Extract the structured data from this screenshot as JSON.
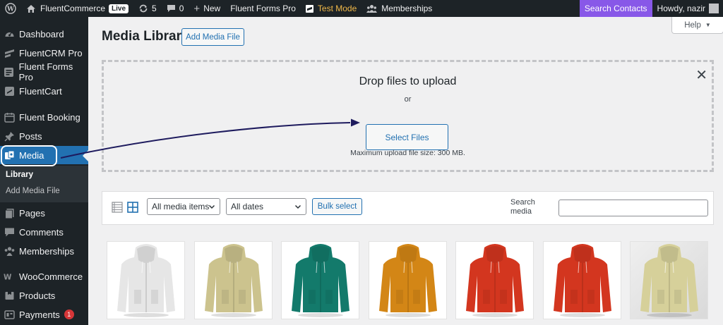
{
  "adminbar": {
    "site_name": "FluentCommerce",
    "live_badge": "Live",
    "updates_count": "5",
    "comments_count": "0",
    "new_label": "New",
    "forms_label": "Fluent Forms Pro",
    "test_mode_label": "Test Mode",
    "memberships_label": "Memberships",
    "search_contacts_label": "Search Contacts",
    "howdy_label": "Howdy, nazir"
  },
  "sidebar": {
    "items": [
      {
        "label": "Dashboard",
        "icon": "dashboard-icon"
      },
      {
        "label": "FluentCRM Pro",
        "icon": "fluentcrm-icon"
      },
      {
        "label": "Fluent Forms Pro",
        "icon": "fluentforms-icon"
      },
      {
        "label": "FluentCart",
        "icon": "fluentcart-icon"
      },
      {
        "label": "Fluent Booking",
        "icon": "calendar-icon"
      },
      {
        "label": "Posts",
        "icon": "pin-icon"
      },
      {
        "label": "Media",
        "icon": "media-icon"
      },
      {
        "label": "Pages",
        "icon": "pages-icon"
      },
      {
        "label": "Comments",
        "icon": "comments-icon"
      },
      {
        "label": "Memberships",
        "icon": "memberships-icon"
      },
      {
        "label": "WooCommerce",
        "icon": "woocommerce-icon"
      },
      {
        "label": "Products",
        "icon": "products-icon"
      },
      {
        "label": "Payments",
        "icon": "payments-icon"
      }
    ],
    "submenu": [
      "Library",
      "Add Media File"
    ],
    "payments_badge": "1"
  },
  "main": {
    "help_label": "Help",
    "title": "Media Library",
    "add_button": "Add Media File",
    "upload": {
      "title": "Drop files to upload",
      "or": "or",
      "select_button": "Select Files",
      "max_size": "Maximum upload file size: 300 MB."
    },
    "toolbar": {
      "filter_type": "All media items",
      "filter_date": "All dates",
      "bulk_select": "Bulk select",
      "search_label": "Search media",
      "search_value": ""
    },
    "thumbnails": [
      {
        "color": "#e6e6e6",
        "name": "white-hoodie"
      },
      {
        "color": "#ccc38e",
        "name": "beige-hoodie"
      },
      {
        "color": "#137a6b",
        "name": "teal-hoodie"
      },
      {
        "color": "#d38616",
        "name": "orange-hoodie"
      },
      {
        "color": "#d3361f",
        "name": "red-hoodie"
      },
      {
        "color": "#d3361f",
        "name": "red-hoodie"
      },
      {
        "color": "#d6d09a",
        "name": "beige-hoodie-photo"
      }
    ]
  },
  "colors": {
    "admin_dark": "#1d2327",
    "accent": "#2271b1",
    "search_purple": "#8858e8",
    "badge_red": "#d63638",
    "arrow_navy": "#1e1b5e"
  }
}
